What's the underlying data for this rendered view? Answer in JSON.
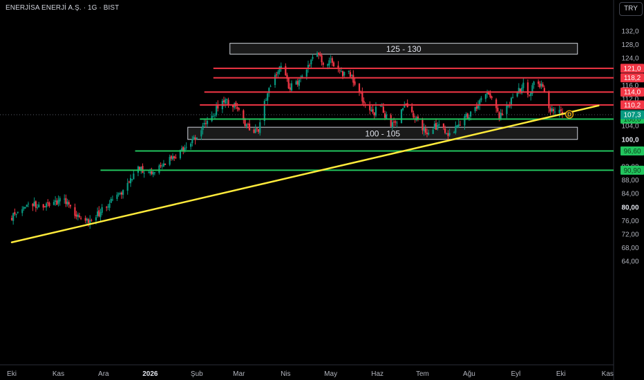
{
  "header": {
    "title": "ENERJİSA ENERJİ A.Ş. · 1G · BIST",
    "currency": "TRY"
  },
  "chart_data": {
    "type": "candlestick",
    "symbol": "ENERJİSA ENERJİ A.Ş.",
    "interval": "1G",
    "exchange": "BIST",
    "currency": "TRY",
    "ylim": [
      62.2,
      135.0
    ],
    "y_ticks": [
      {
        "v": 132,
        "label": "132,0"
      },
      {
        "v": 128,
        "label": "128,0"
      },
      {
        "v": 124,
        "label": "124,0"
      },
      {
        "v": 116,
        "label": "116,0"
      },
      {
        "v": 112,
        "label": "112,0"
      },
      {
        "v": 104,
        "label": "104,0"
      },
      {
        "v": 100,
        "label": "100,0",
        "bold": true
      },
      {
        "v": 92,
        "label": "92,00"
      },
      {
        "v": 88,
        "label": "88,00"
      },
      {
        "v": 84,
        "label": "84,00"
      },
      {
        "v": 80,
        "label": "80,00",
        "bold": true
      },
      {
        "v": 76,
        "label": "76,00"
      },
      {
        "v": 72,
        "label": "72,00"
      },
      {
        "v": 68,
        "label": "68,00"
      },
      {
        "v": 64,
        "label": "64,00"
      }
    ],
    "x_ticks": [
      {
        "label": "Eki",
        "day": 0
      },
      {
        "label": "Kas",
        "day": 31
      },
      {
        "label": "Ara",
        "day": 61
      },
      {
        "label": "2026",
        "day": 92,
        "bold": true
      },
      {
        "label": "Şub",
        "day": 123
      },
      {
        "label": "Mar",
        "day": 151
      },
      {
        "label": "Nis",
        "day": 182
      },
      {
        "label": "May",
        "day": 212
      },
      {
        "label": "Haz",
        "day": 243
      },
      {
        "label": "Tem",
        "day": 273
      },
      {
        "label": "Ağu",
        "day": 304
      },
      {
        "label": "Eyl",
        "day": 335
      },
      {
        "label": "Eki",
        "day": 365
      },
      {
        "label": "Kas",
        "day": 396
      }
    ],
    "current_price": {
      "value": 107.3,
      "label": "107,3",
      "color": "#089981"
    },
    "resistance_lines": [
      {
        "value": 121.0,
        "label": "121,0",
        "start_day": 134,
        "color": "#f23645"
      },
      {
        "value": 118.2,
        "label": "118,2",
        "start_day": 134,
        "color": "#f23645"
      },
      {
        "value": 114.0,
        "label": "114,0",
        "start_day": 128,
        "color": "#f23645"
      },
      {
        "value": 110.2,
        "label": "110,2",
        "start_day": 125,
        "color": "#f23645"
      }
    ],
    "support_lines": [
      {
        "value": 106.0,
        "label": "106,0",
        "start_day": 125,
        "color": "#22c55e"
      },
      {
        "value": 96.6,
        "label": "96,60",
        "start_day": 82,
        "color": "#22c55e"
      },
      {
        "value": 90.9,
        "label": "90,90",
        "start_day": 59,
        "color": "#22c55e"
      }
    ],
    "zones": [
      {
        "label": "125 - 130",
        "low": 125.2,
        "high": 128.4,
        "start_day": 145,
        "end_day": 376
      },
      {
        "label": "100 - 105",
        "low": 100.0,
        "high": 103.6,
        "start_day": 117,
        "end_day": 376
      }
    ],
    "trendline": {
      "color": "#ffeb3b",
      "from": {
        "day": 0,
        "value": 69.6
      },
      "to": {
        "day": 390,
        "value": 110.0
      }
    },
    "marker": {
      "label": "D",
      "day": 366,
      "value": 107.4
    },
    "keypoints": [
      {
        "day": 0,
        "value": 77.0
      },
      {
        "day": 6,
        "value": 79.5
      },
      {
        "day": 12,
        "value": 82.0
      },
      {
        "day": 18,
        "value": 80.0
      },
      {
        "day": 26,
        "value": 81.0
      },
      {
        "day": 34,
        "value": 82.5
      },
      {
        "day": 42,
        "value": 77.5
      },
      {
        "day": 48,
        "value": 75.5
      },
      {
        "day": 56,
        "value": 77.5
      },
      {
        "day": 64,
        "value": 80.5
      },
      {
        "day": 72,
        "value": 84.0
      },
      {
        "day": 78,
        "value": 86.5
      },
      {
        "day": 84,
        "value": 92.5
      },
      {
        "day": 90,
        "value": 89.5
      },
      {
        "day": 96,
        "value": 91.0
      },
      {
        "day": 102,
        "value": 93.0
      },
      {
        "day": 108,
        "value": 95.0
      },
      {
        "day": 114,
        "value": 97.0
      },
      {
        "day": 120,
        "value": 99.5
      },
      {
        "day": 126,
        "value": 103.0
      },
      {
        "day": 132,
        "value": 106.5
      },
      {
        "day": 138,
        "value": 110.0
      },
      {
        "day": 142,
        "value": 112.0
      },
      {
        "day": 146,
        "value": 110.5
      },
      {
        "day": 152,
        "value": 108.5
      },
      {
        "day": 156,
        "value": 104.0
      },
      {
        "day": 160,
        "value": 102.0
      },
      {
        "day": 164,
        "value": 103.0
      },
      {
        "day": 168,
        "value": 110.5
      },
      {
        "day": 172,
        "value": 116.0
      },
      {
        "day": 176,
        "value": 120.0
      },
      {
        "day": 180,
        "value": 123.0
      },
      {
        "day": 184,
        "value": 115.0
      },
      {
        "day": 188,
        "value": 116.0
      },
      {
        "day": 192,
        "value": 118.5
      },
      {
        "day": 196,
        "value": 121.0
      },
      {
        "day": 200,
        "value": 123.5
      },
      {
        "day": 204,
        "value": 126.0
      },
      {
        "day": 208,
        "value": 120.0
      },
      {
        "day": 212,
        "value": 124.0
      },
      {
        "day": 216,
        "value": 121.0
      },
      {
        "day": 220,
        "value": 119.0
      },
      {
        "day": 224,
        "value": 120.5
      },
      {
        "day": 228,
        "value": 116.5
      },
      {
        "day": 232,
        "value": 113.0
      },
      {
        "day": 236,
        "value": 110.0
      },
      {
        "day": 240,
        "value": 107.0
      },
      {
        "day": 244,
        "value": 111.0
      },
      {
        "day": 248,
        "value": 107.0
      },
      {
        "day": 252,
        "value": 104.5
      },
      {
        "day": 256,
        "value": 106.0
      },
      {
        "day": 260,
        "value": 109.5
      },
      {
        "day": 264,
        "value": 110.5
      },
      {
        "day": 268,
        "value": 106.5
      },
      {
        "day": 272,
        "value": 103.5
      },
      {
        "day": 276,
        "value": 102.5
      },
      {
        "day": 280,
        "value": 103.5
      },
      {
        "day": 284,
        "value": 104.0
      },
      {
        "day": 288,
        "value": 102.0
      },
      {
        "day": 292,
        "value": 101.0
      },
      {
        "day": 296,
        "value": 103.5
      },
      {
        "day": 300,
        "value": 106.0
      },
      {
        "day": 304,
        "value": 107.0
      },
      {
        "day": 308,
        "value": 109.0
      },
      {
        "day": 312,
        "value": 112.0
      },
      {
        "day": 316,
        "value": 114.5
      },
      {
        "day": 320,
        "value": 111.0
      },
      {
        "day": 324,
        "value": 107.0
      },
      {
        "day": 328,
        "value": 109.5
      },
      {
        "day": 332,
        "value": 111.5
      },
      {
        "day": 336,
        "value": 114.0
      },
      {
        "day": 340,
        "value": 116.0
      },
      {
        "day": 344,
        "value": 112.5
      },
      {
        "day": 348,
        "value": 117.5
      },
      {
        "day": 352,
        "value": 116.0
      },
      {
        "day": 356,
        "value": 110.5
      },
      {
        "day": 360,
        "value": 107.5
      },
      {
        "day": 364,
        "value": 109.0
      },
      {
        "day": 366,
        "value": 107.3
      }
    ]
  }
}
